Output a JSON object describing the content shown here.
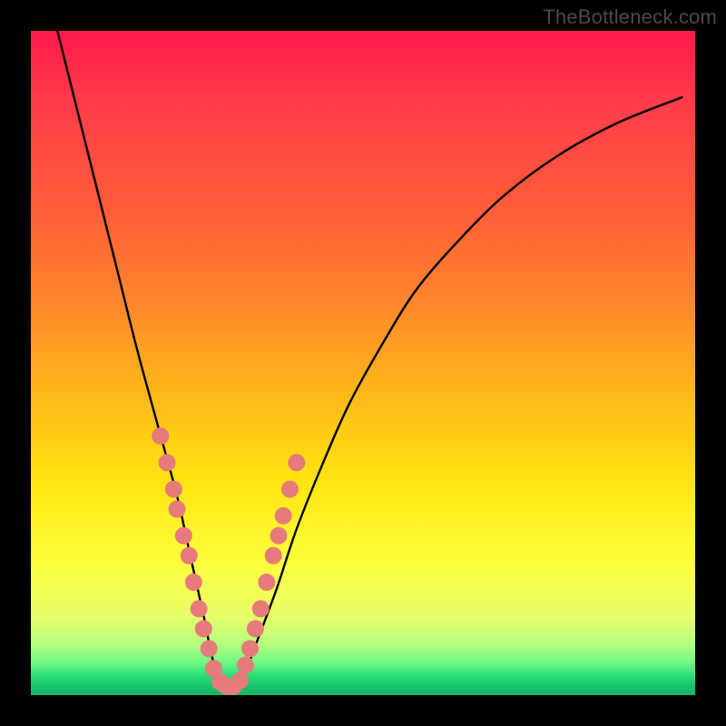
{
  "watermark": {
    "text": "TheBottleneck.com"
  },
  "chart_data": {
    "type": "line",
    "title": "",
    "xlabel": "",
    "ylabel": "",
    "xlim": [
      0,
      100
    ],
    "ylim": [
      0,
      100
    ],
    "grid": false,
    "legend": false,
    "series": [
      {
        "name": "bottleneck-curve",
        "color": "#000000",
        "x": [
          4,
          7,
          10,
          13,
          16,
          19,
          22,
          24,
          26,
          27,
          28,
          29,
          30,
          32,
          34,
          37,
          40,
          44,
          48,
          53,
          58,
          64,
          71,
          79,
          88,
          98
        ],
        "y": [
          100,
          88,
          76,
          64,
          52,
          41,
          30,
          21,
          12,
          7,
          3,
          1,
          1,
          3,
          8,
          16,
          25,
          35,
          44,
          53,
          61,
          68,
          75,
          81,
          86,
          90
        ]
      }
    ],
    "markers": {
      "name": "highlighted-points",
      "color": "#e77b7b",
      "radius_pct": 1.3,
      "points_xy": [
        [
          19.5,
          39
        ],
        [
          20.5,
          35
        ],
        [
          21.5,
          31
        ],
        [
          22.0,
          28
        ],
        [
          23.0,
          24
        ],
        [
          23.8,
          21
        ],
        [
          24.5,
          17
        ],
        [
          25.3,
          13
        ],
        [
          26.0,
          10
        ],
        [
          26.8,
          7
        ],
        [
          27.5,
          4
        ],
        [
          28.5,
          2
        ],
        [
          29.5,
          1.3
        ],
        [
          30.5,
          1.3
        ],
        [
          31.5,
          2.2
        ],
        [
          32.3,
          4.5
        ],
        [
          33.0,
          7
        ],
        [
          33.8,
          10
        ],
        [
          34.6,
          13
        ],
        [
          35.5,
          17
        ],
        [
          36.5,
          21
        ],
        [
          37.3,
          24
        ],
        [
          38.0,
          27
        ],
        [
          39.0,
          31
        ],
        [
          40.0,
          35
        ]
      ]
    },
    "background_gradient": {
      "top_color": "#ff1a4b",
      "mid_color": "#ffe50f",
      "bottom_color": "#18b566"
    }
  }
}
